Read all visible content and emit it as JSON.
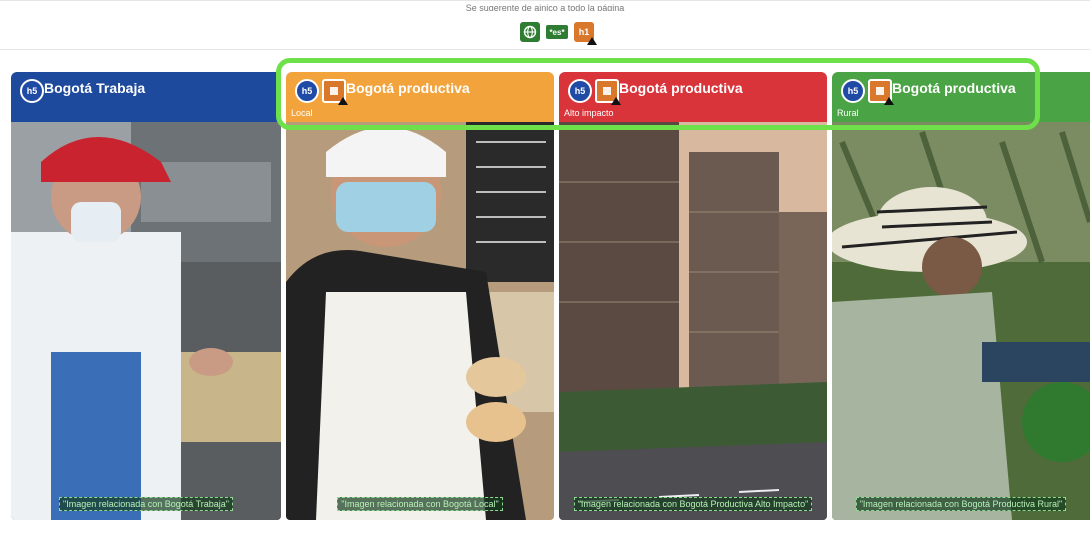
{
  "top": {
    "notice": "Se sugerente de ajnico a todo la página",
    "tools": [
      {
        "icon": "globe-icon"
      },
      {
        "icon": "language-icon",
        "label": "*es*"
      },
      {
        "icon": "heading-h1-icon",
        "label": "h1"
      }
    ]
  },
  "cards": [
    {
      "title": "Bogotá Trabaja",
      "subtitle": "",
      "color": "#1d4a9c",
      "badge_h5": "h5",
      "caption": "\"Imagen relacionada con Bogotá Trabaja\""
    },
    {
      "title": "Bogotá productiva",
      "subtitle": "Local",
      "color": "#f2a33c",
      "badge_h5": "h5",
      "caption": "\"Imagen relacionada con Bogotá Local\""
    },
    {
      "title": "Bogotá productiva",
      "subtitle": "Alto impacto",
      "color": "#d9343a",
      "badge_h5": "h5",
      "caption": "\"Imagen relacionada con Bogotá Productiva Alto Impacto\""
    },
    {
      "title": "Bogotá productiva",
      "subtitle": "Rural",
      "color": "#4aa344",
      "badge_h5": "h5",
      "caption": "\"Imagen relacionada con Bogotá Productiva Rural\""
    }
  ],
  "highlight_color": "#6ee14a"
}
